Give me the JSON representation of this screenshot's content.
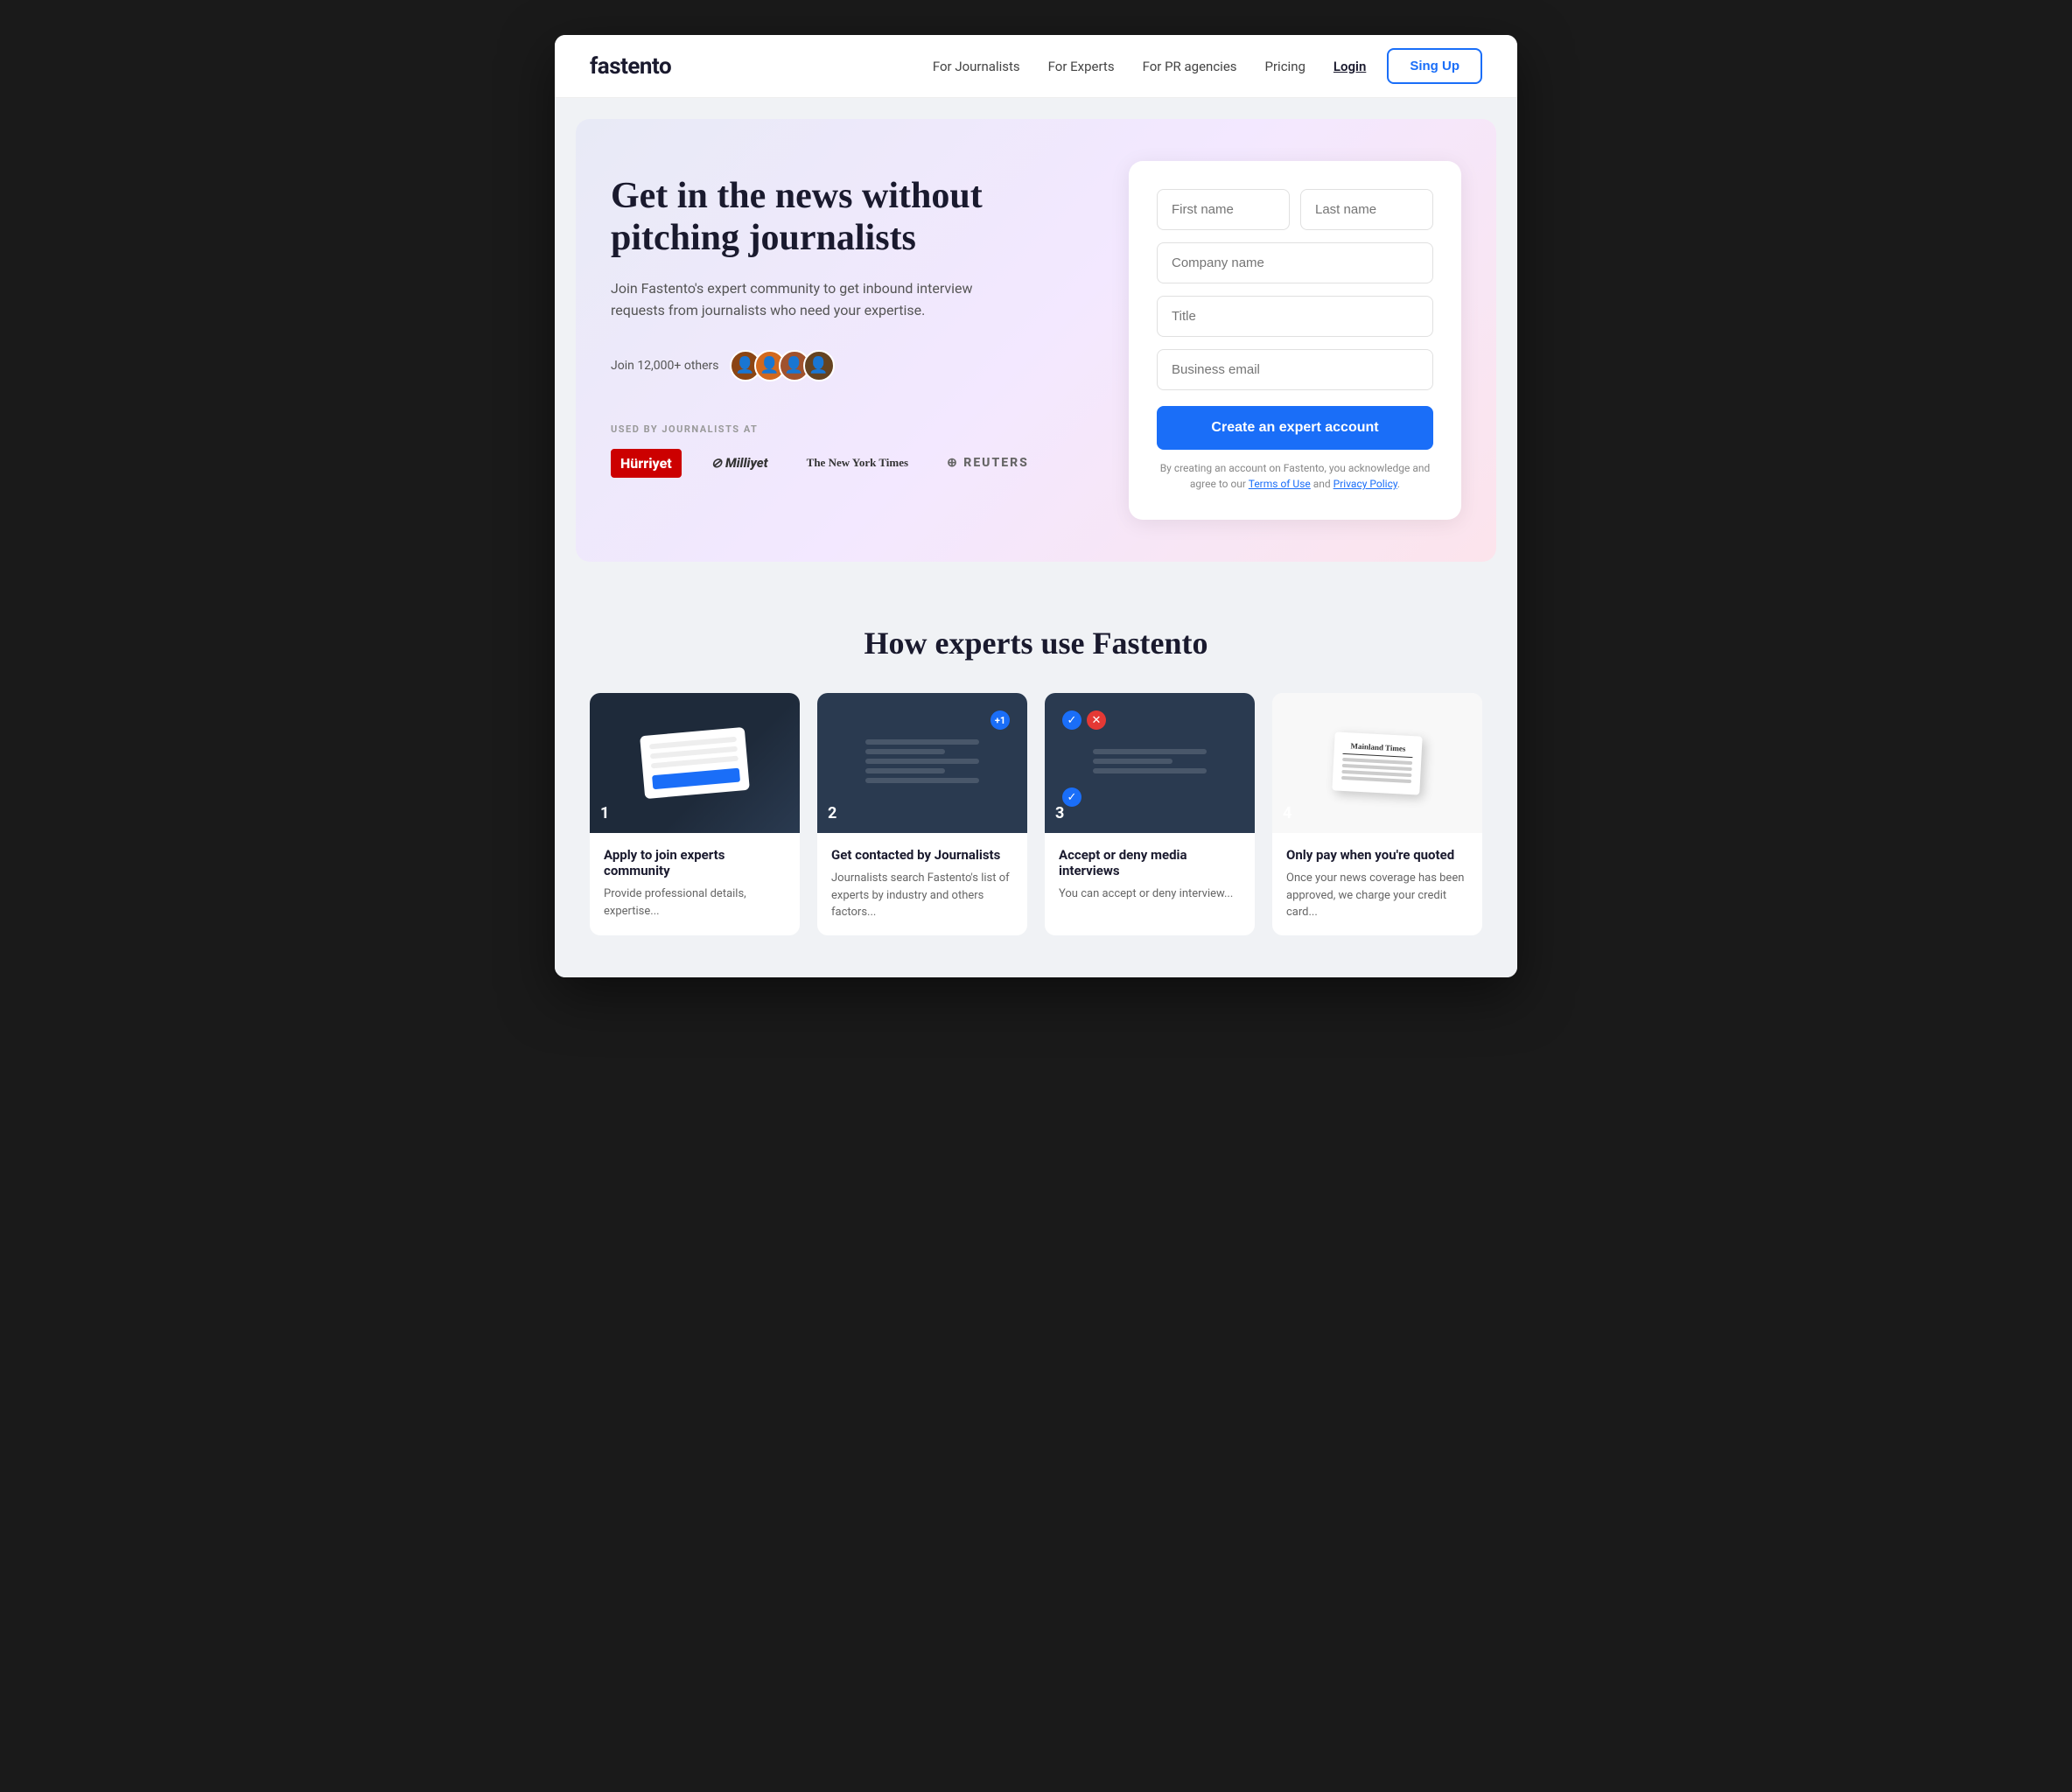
{
  "brand": {
    "name": "fastento"
  },
  "nav": {
    "links": [
      {
        "label": "For Journalists",
        "href": "#",
        "active": false
      },
      {
        "label": "For Experts",
        "href": "#",
        "active": false
      },
      {
        "label": "For PR agencies",
        "href": "#",
        "active": false
      },
      {
        "label": "Pricing",
        "href": "#",
        "active": false
      },
      {
        "label": "Login",
        "href": "#",
        "active": true
      }
    ],
    "signup_label": "Sing Up"
  },
  "hero": {
    "title": "Get in the news without pitching journalists",
    "subtitle": "Join Fastento's expert community to get inbound interview requests from journalists who need your expertise.",
    "join_text": "Join 12,000+ others",
    "used_by_label": "USED BY JOURNALISTS AT",
    "logos": [
      "Hürriyet",
      "Milliyet",
      "The New York Times",
      "REUTERS"
    ]
  },
  "form": {
    "first_name_placeholder": "First name",
    "last_name_placeholder": "Last name",
    "company_placeholder": "Company name",
    "title_placeholder": "Title",
    "email_placeholder": "Business email",
    "submit_label": "Create an expert account",
    "disclaimer": "By creating an account on Fastento, you acknowledge and agree to our Terms of Use and Privacy Policy."
  },
  "how_section": {
    "title": "How experts use Fastento",
    "steps": [
      {
        "number": "1",
        "title": "Apply to join experts community",
        "desc": "Provide professional details, expertise..."
      },
      {
        "number": "2",
        "title": "Get contacted by Journalists",
        "desc": "Journalists search Fastento's list of experts by industry and others factors..."
      },
      {
        "number": "3",
        "title": "Accept or deny media interviews",
        "desc": "You can accept or deny interview..."
      },
      {
        "number": "4",
        "title": "Only pay when you're quoted",
        "desc": "Once your news coverage has been approved, we charge your credit card..."
      }
    ]
  }
}
